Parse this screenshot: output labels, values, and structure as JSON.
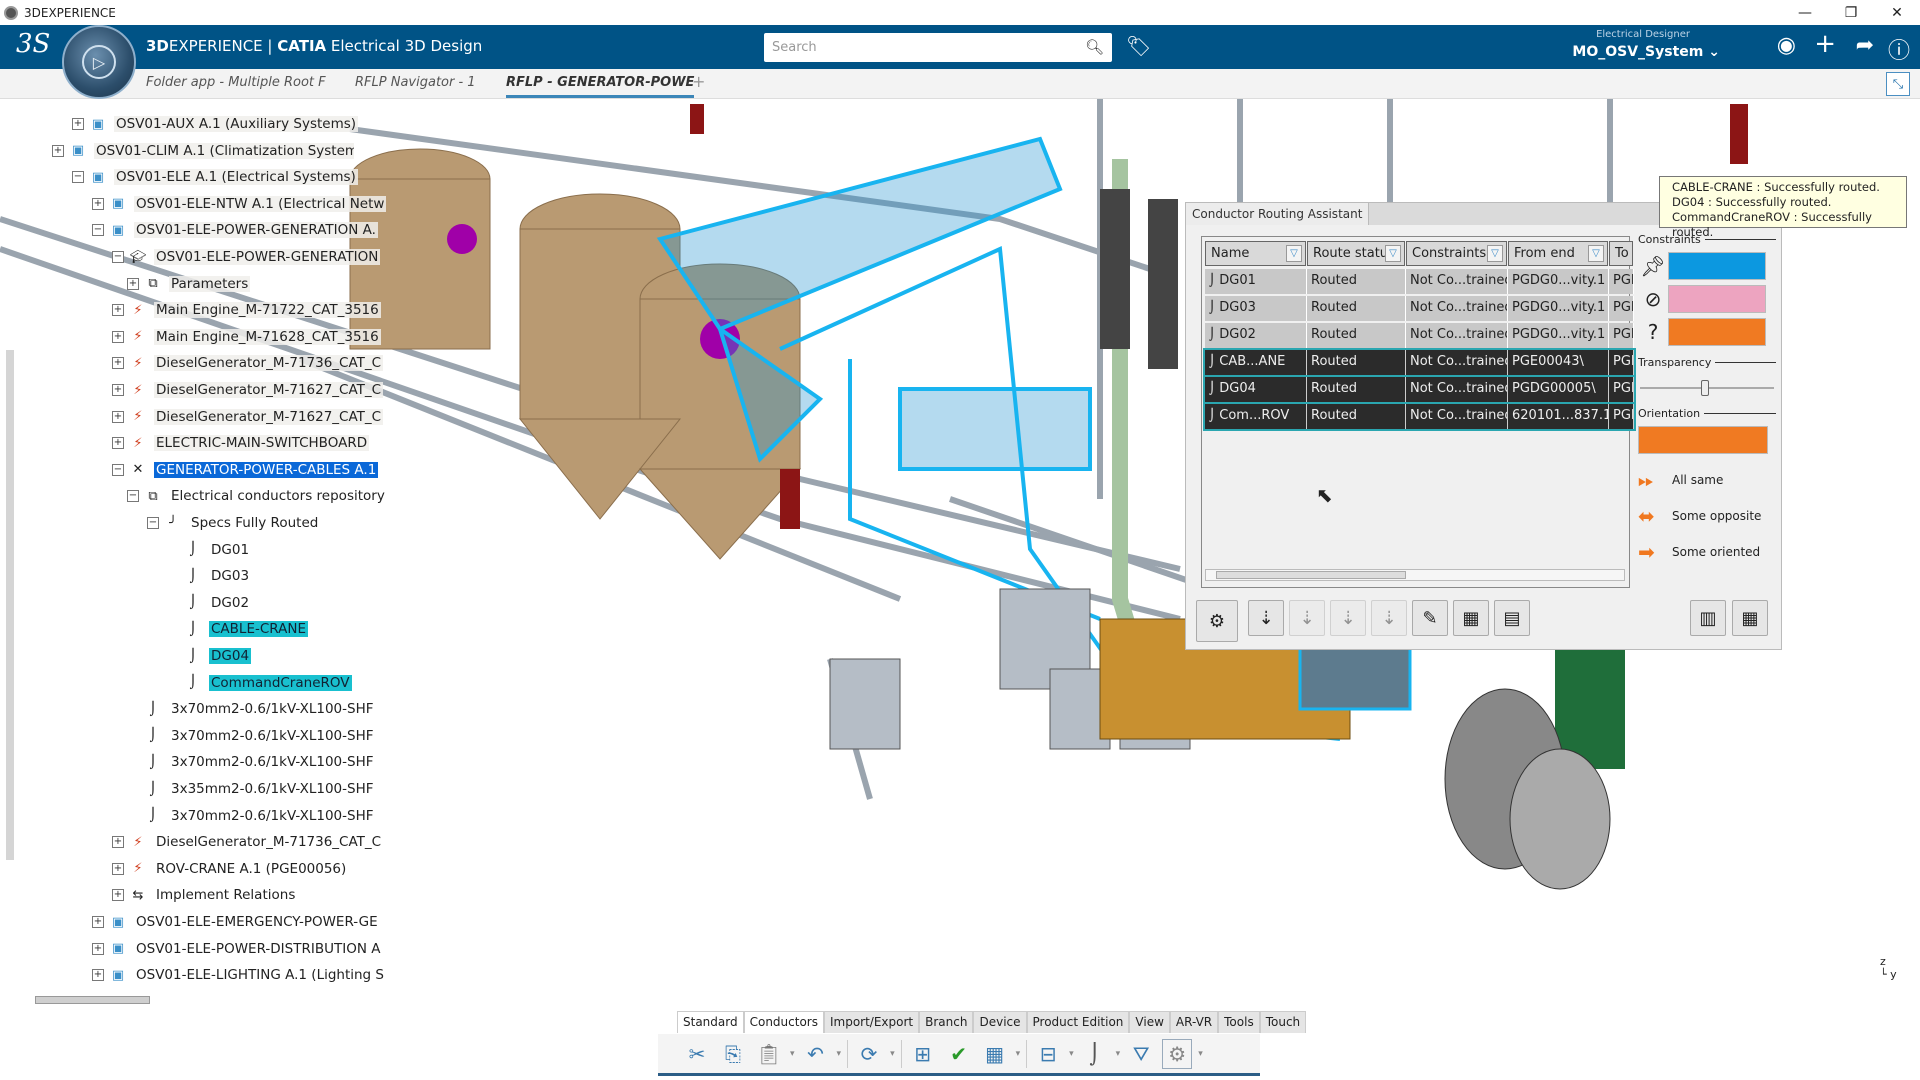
{
  "window": {
    "title": "3DEXPERIENCE",
    "controls": [
      "minimize",
      "restore",
      "close"
    ]
  },
  "header": {
    "brand_bold": "3D",
    "brand_rest": "EXPERIENCE | ",
    "brand_catia": "CATIA",
    "app": " Electrical 3D Design",
    "search_placeholder": "Search",
    "role": "Electrical  Designer",
    "workspace": "MO_OSV_System"
  },
  "tabs": [
    {
      "label": "Folder app - Multiple Root F"
    },
    {
      "label": "RFLP Navigator - 1"
    },
    {
      "label": "RFLP - GENERATOR-POWE"
    }
  ],
  "tree": [
    {
      "label": "OSV01-AUX A.1 (Auxiliary Systems)",
      "pm": "+"
    },
    {
      "label": "OSV01-CLIM A.1 (Climatization Systems",
      "pm": "+"
    },
    {
      "label": "OSV01-ELE A.1 (Electrical Systems)",
      "pm": "−"
    },
    {
      "label": "OSV01-ELE-NTW A.1 (Electrical Netw",
      "pm": "+"
    },
    {
      "label": "OSV01-ELE-POWER-GENERATION A.",
      "pm": "−"
    },
    {
      "label": "OSV01-ELE-POWER-GENERATION",
      "pm": "−"
    },
    {
      "label": "Parameters",
      "pm": "+"
    },
    {
      "label": "Main Engine_M-71722_CAT_3516",
      "pm": "+"
    },
    {
      "label": "Main Engine_M-71628_CAT_3516",
      "pm": "+"
    },
    {
      "label": "DieselGenerator_M-71736_CAT_C",
      "pm": "+"
    },
    {
      "label": "DieselGenerator_M-71627_CAT_C",
      "pm": "+"
    },
    {
      "label": "DieselGenerator_M-71627_CAT_C",
      "pm": "+"
    },
    {
      "label": "ELECTRIC-MAIN-SWITCHBOARD",
      "pm": "+"
    },
    {
      "label": "GENERATOR-POWER-CABLES A.1",
      "pm": "−"
    },
    {
      "label": "Electrical conductors repository",
      "pm": "−"
    },
    {
      "label": "Specs Fully Routed",
      "pm": "−"
    },
    {
      "label": "DG01"
    },
    {
      "label": "DG03"
    },
    {
      "label": "DG02"
    },
    {
      "label": "CABLE-CRANE"
    },
    {
      "label": "DG04"
    },
    {
      "label": "CommandCraneROV"
    },
    {
      "label": "3x70mm2-0.6/1kV-XL100-SHF"
    },
    {
      "label": "3x70mm2-0.6/1kV-XL100-SHF"
    },
    {
      "label": "3x70mm2-0.6/1kV-XL100-SHF"
    },
    {
      "label": "3x35mm2-0.6/1kV-XL100-SHF"
    },
    {
      "label": "3x70mm2-0.6/1kV-XL100-SHF"
    },
    {
      "label": "DieselGenerator_M-71736_CAT_C",
      "pm": "+"
    },
    {
      "label": "ROV-CRANE A.1 (PGE00056)",
      "pm": "+"
    },
    {
      "label": "Implement Relations",
      "pm": "+"
    },
    {
      "label": "OSV01-ELE-EMERGENCY-POWER-GE",
      "pm": "+"
    },
    {
      "label": "OSV01-ELE-POWER-DISTRIBUTION A",
      "pm": "+"
    },
    {
      "label": "OSV01-ELE-LIGHTING A.1 (Lighting S",
      "pm": "+"
    }
  ],
  "panel": {
    "title": "Conductor Routing Assistant",
    "columns": [
      "Name",
      "Route statu",
      "Constraints",
      "From end",
      "To"
    ],
    "rows": [
      {
        "name": "DG01",
        "status": "Routed",
        "constraints": "Not Co...trained",
        "from": "PGDG0...vity.1",
        "to": "PGI"
      },
      {
        "name": "DG03",
        "status": "Routed",
        "constraints": "Not Co...trained",
        "from": "PGDG0...vity.1",
        "to": "PGI"
      },
      {
        "name": "DG02",
        "status": "Routed",
        "constraints": "Not Co...trained",
        "from": "PGDG0...vity.1",
        "to": "PGI"
      },
      {
        "name": "CAB...ANE",
        "status": "Routed",
        "constraints": "Not Co...trained",
        "from": "PGE00043\\",
        "to": "PGI"
      },
      {
        "name": "DG04",
        "status": "Routed",
        "constraints": "Not Co...trained",
        "from": "PGDG00005\\",
        "to": "PGI"
      },
      {
        "name": "Com...ROV",
        "status": "Routed",
        "constraints": "Not Co...trained",
        "from": "620101...837.1\\",
        "to": "PGI"
      }
    ],
    "constraints_label": "Constraints",
    "constraint_colors": {
      "fixed": "#0c98e0",
      "forbidden": "#eda4c0",
      "unknown": "#f07a22"
    },
    "transparency_label": "Transparency",
    "transparency_value": 0.5,
    "orientation_label": "Orientation",
    "orientation_color": "#f07a22",
    "orientation_options": [
      "All same",
      "Some opposite",
      "Some oriented"
    ]
  },
  "tooltip": [
    "CABLE-CRANE : Successfully routed.",
    "DG04 : Successfully routed.",
    "CommandCraneROV : Successfully routed."
  ],
  "bottom_tabs": [
    "Standard",
    "Conductors",
    "Import/Export",
    "Branch",
    "Device",
    "Product Edition",
    "View",
    "AR-VR",
    "Tools",
    "Touch"
  ]
}
